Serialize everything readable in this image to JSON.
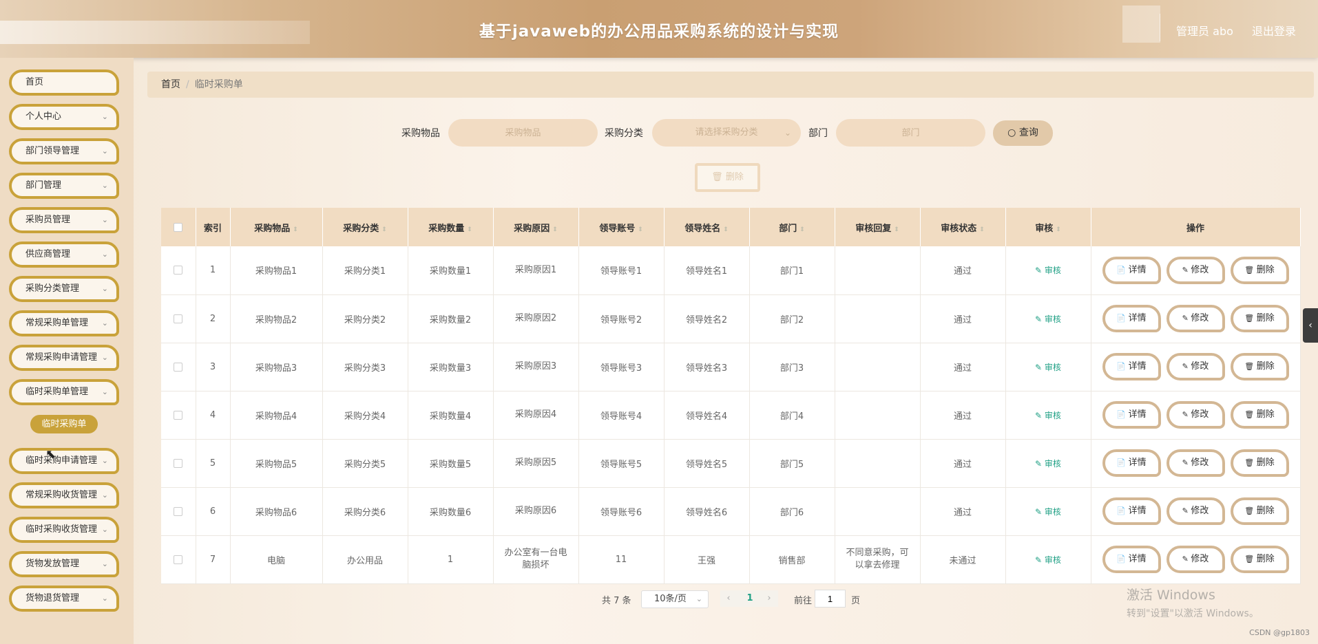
{
  "header": {
    "title": "基于javaweb的办公用品采购系统的设计与实现",
    "user_label": "管理员 abo",
    "logout_label": "退出登录"
  },
  "sidebar": {
    "items": [
      {
        "label": "首页"
      },
      {
        "label": "个人中心"
      },
      {
        "label": "部门领导管理"
      },
      {
        "label": "部门管理"
      },
      {
        "label": "采购员管理"
      },
      {
        "label": "供应商管理"
      },
      {
        "label": "采购分类管理"
      },
      {
        "label": "常规采购单管理"
      },
      {
        "label": "常规采购申请管理"
      },
      {
        "label": "临时采购单管理"
      },
      {
        "label": "临时采购申请管理"
      },
      {
        "label": "常规采购收货管理"
      },
      {
        "label": "临时采购收货管理"
      },
      {
        "label": "货物发放管理"
      },
      {
        "label": "货物退货管理"
      }
    ],
    "active_sub": "临时采购单"
  },
  "breadcrumb": {
    "home": "首页",
    "separator": "/",
    "current": "临时采购单"
  },
  "search": {
    "item_label": "采购物品",
    "item_placeholder": "采购物品",
    "category_label": "采购分类",
    "category_placeholder": "请选择采购分类",
    "dept_label": "部门",
    "dept_placeholder": "部门",
    "query_label": "查询"
  },
  "delete_batch_label": "删除",
  "table": {
    "headers": [
      "索引",
      "采购物品",
      "采购分类",
      "采购数量",
      "采购原因",
      "领导账号",
      "领导姓名",
      "部门",
      "审核回复",
      "审核状态",
      "审核",
      "操作"
    ],
    "audit_label": "审核",
    "op_labels": {
      "detail": "详情",
      "edit": "修改",
      "delete": "删除"
    },
    "rows": [
      {
        "idx": "1",
        "item": "采购物品1",
        "cat": "采购分类1",
        "qty": "采购数量1",
        "reason": "采购原因1",
        "acct": "领导账号1",
        "leader": "领导姓名1",
        "dept": "部门1",
        "reply": "",
        "status": "通过"
      },
      {
        "idx": "2",
        "item": "采购物品2",
        "cat": "采购分类2",
        "qty": "采购数量2",
        "reason": "采购原因2",
        "acct": "领导账号2",
        "leader": "领导姓名2",
        "dept": "部门2",
        "reply": "",
        "status": "通过"
      },
      {
        "idx": "3",
        "item": "采购物品3",
        "cat": "采购分类3",
        "qty": "采购数量3",
        "reason": "采购原因3",
        "acct": "领导账号3",
        "leader": "领导姓名3",
        "dept": "部门3",
        "reply": "",
        "status": "通过"
      },
      {
        "idx": "4",
        "item": "采购物品4",
        "cat": "采购分类4",
        "qty": "采购数量4",
        "reason": "采购原因4",
        "acct": "领导账号4",
        "leader": "领导姓名4",
        "dept": "部门4",
        "reply": "",
        "status": "通过"
      },
      {
        "idx": "5",
        "item": "采购物品5",
        "cat": "采购分类5",
        "qty": "采购数量5",
        "reason": "采购原因5",
        "acct": "领导账号5",
        "leader": "领导姓名5",
        "dept": "部门5",
        "reply": "",
        "status": "通过"
      },
      {
        "idx": "6",
        "item": "采购物品6",
        "cat": "采购分类6",
        "qty": "采购数量6",
        "reason": "采购原因6",
        "acct": "领导账号6",
        "leader": "领导姓名6",
        "dept": "部门6",
        "reply": "",
        "status": "通过"
      },
      {
        "idx": "7",
        "item": "电脑",
        "cat": "办公用品",
        "qty": "1",
        "reason": "办公室有一台电脑损坏",
        "acct": "11",
        "leader": "王强",
        "dept": "销售部",
        "reply": "不同意采购，可以拿去修理",
        "status": "未通过"
      }
    ]
  },
  "pagination": {
    "total": "共 7 条",
    "page_size": "10条/页",
    "current_page": "1",
    "goto_label": "前往",
    "goto_value": "1",
    "page_suffix": "页"
  },
  "watermark": {
    "line1": "激活 Windows",
    "line2": "转到\"设置\"以激活 Windows。"
  },
  "credit": "CSDN @gp1803"
}
